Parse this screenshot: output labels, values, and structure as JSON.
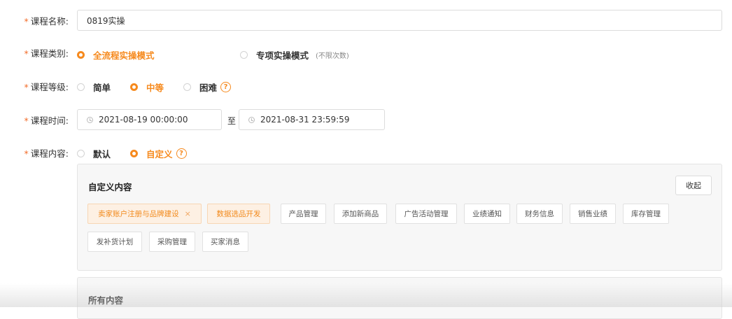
{
  "form": {
    "name": {
      "label": "课程名称:",
      "value": "0819实操"
    },
    "category": {
      "label": "课程类别:",
      "options": [
        {
          "label": "全流程实操模式",
          "note": ""
        },
        {
          "label": "专项实操模式",
          "note": "(不限次数)"
        }
      ],
      "selected": 0
    },
    "level": {
      "label": "课程等级:",
      "options": [
        {
          "label": "简单"
        },
        {
          "label": "中等"
        },
        {
          "label": "困难"
        }
      ],
      "selected": 1,
      "help_icon": "question-circle-icon",
      "help_glyph": "?"
    },
    "time": {
      "label": "课程时间:",
      "start": "2021-08-19 00:00:00",
      "separator": "至",
      "end": "2021-08-31 23:59:59",
      "icon": "clock-icon"
    },
    "content": {
      "label": "课程内容:",
      "options": [
        {
          "label": "默认"
        },
        {
          "label": "自定义"
        }
      ],
      "selected": 1,
      "help_icon": "question-circle-icon",
      "help_glyph": "?"
    }
  },
  "custom_panel": {
    "title": "自定义内容",
    "collapse_label": "收起",
    "tags": [
      {
        "label": "卖家账户注册与品牌建设",
        "selected": true,
        "removable": true,
        "remove_glyph": "×"
      },
      {
        "label": "数据选品开发",
        "selected": true,
        "removable": false
      },
      {
        "label": "产品管理",
        "selected": false
      },
      {
        "label": "添加新商品",
        "selected": false
      },
      {
        "label": "广告活动管理",
        "selected": false
      },
      {
        "label": "业绩通知",
        "selected": false
      },
      {
        "label": "财务信息",
        "selected": false
      },
      {
        "label": "销售业绩",
        "selected": false
      },
      {
        "label": "库存管理",
        "selected": false
      },
      {
        "label": "发补货计划",
        "selected": false
      },
      {
        "label": "采购管理",
        "selected": false
      },
      {
        "label": "买家消息",
        "selected": false
      }
    ]
  },
  "all_panel": {
    "title": "所有内容"
  },
  "colors": {
    "accent": "#f68a1e",
    "required_star": "#f26d2a",
    "panel_bg": "#f7f7f7"
  }
}
